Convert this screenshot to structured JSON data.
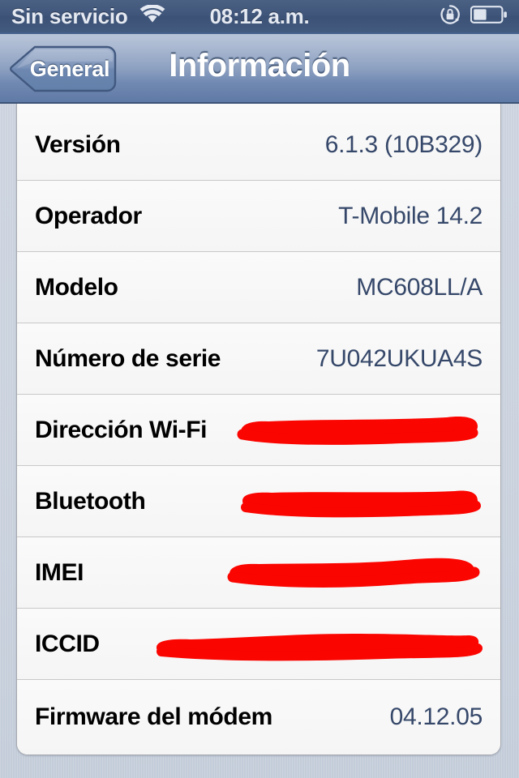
{
  "status_bar": {
    "carrier": "Sin servicio",
    "wifi_icon": "wifi-icon",
    "time": "08:12 a.m.",
    "rotation_lock_icon": "rotation-lock-icon",
    "battery_icon": "battery-icon",
    "battery_level_percent": 48
  },
  "nav_bar": {
    "back_label": "General",
    "title": "Información"
  },
  "info_rows": [
    {
      "label": "Versión",
      "value": "6.1.3 (10B329)",
      "redacted": false
    },
    {
      "label": "Operador",
      "value": "T-Mobile 14.2",
      "redacted": false
    },
    {
      "label": "Modelo",
      "value": "MC608LL/A",
      "redacted": false
    },
    {
      "label": "Número de serie",
      "value": "7U042UKUA4S",
      "redacted": false
    },
    {
      "label": "Dirección Wi-Fi",
      "value": "",
      "redacted": true
    },
    {
      "label": "Bluetooth",
      "value": "",
      "redacted": true
    },
    {
      "label": "IMEI",
      "value": "",
      "redacted": true
    },
    {
      "label": "ICCID",
      "value": "",
      "redacted": true
    },
    {
      "label": "Firmware del módem",
      "value": "04.12.05",
      "redacted": false
    }
  ],
  "colors": {
    "redaction": "#fa0500",
    "value_text": "#36486a",
    "label_text": "#000000",
    "page_background": "#ced5e1",
    "nav_bar_top": "#b9c5d9",
    "nav_bar_bottom": "#5f7aa6",
    "status_bar": "#3f557a",
    "row_background": "#f6f6f6"
  }
}
